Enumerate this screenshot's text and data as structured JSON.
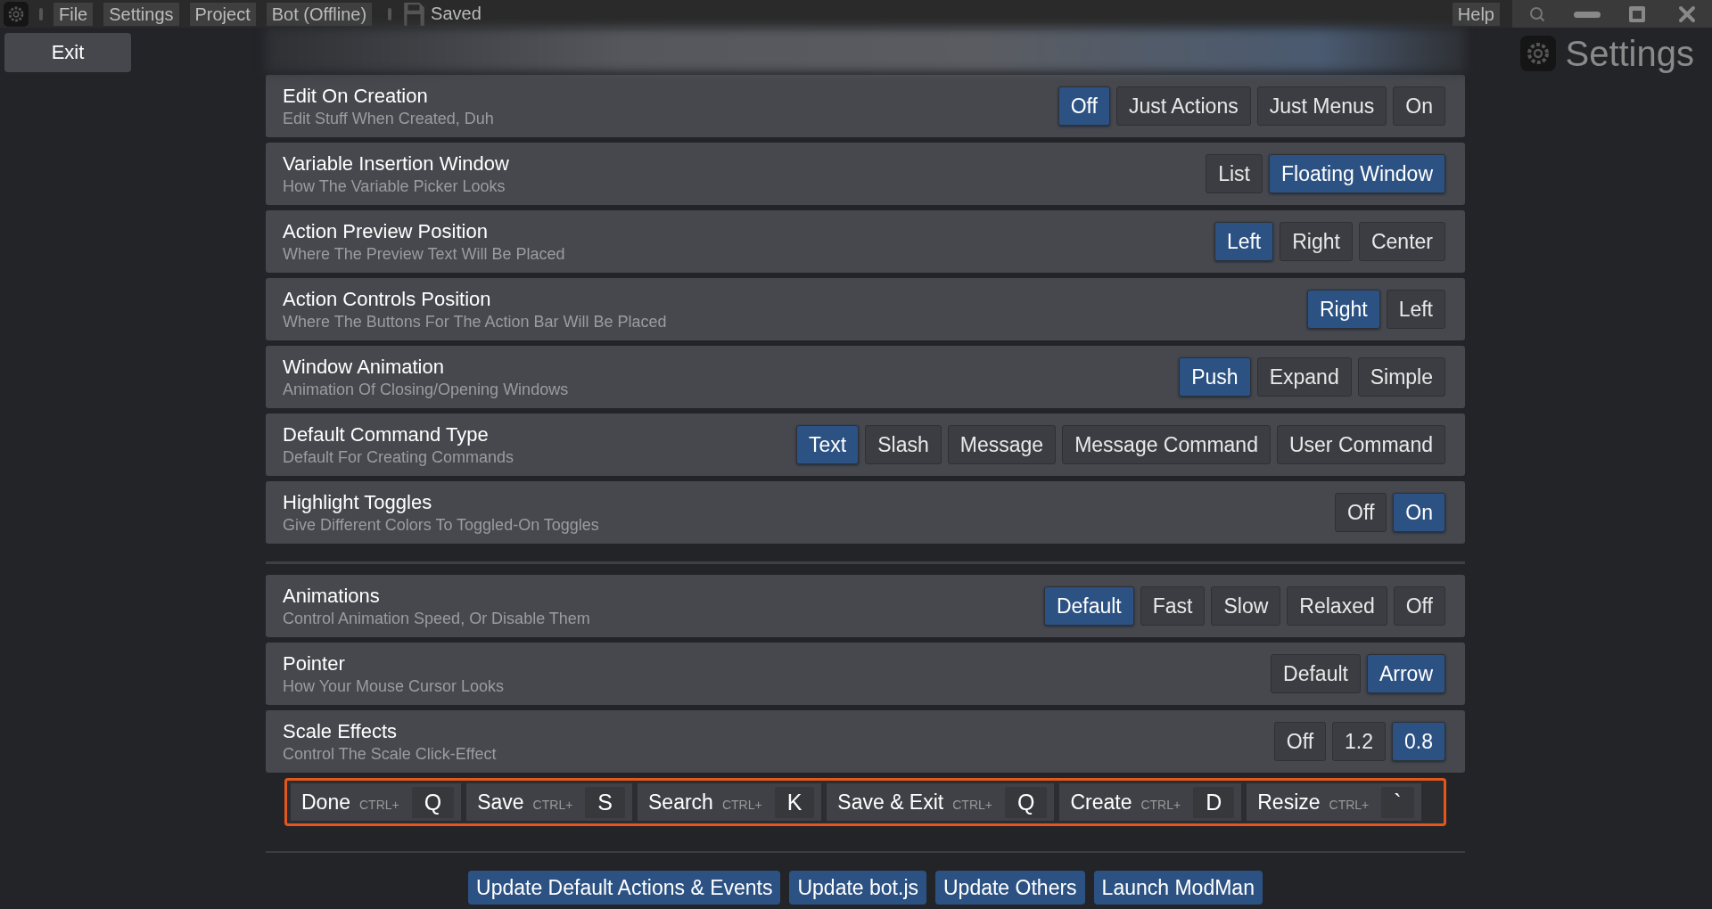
{
  "menu_bar": {
    "items": [
      "File",
      "Settings",
      "Project",
      "Bot (Offline)"
    ],
    "status": "Saved",
    "help": "Help"
  },
  "sidebar": {
    "exit_button": "Exit"
  },
  "panel_title": "Settings",
  "settings_groups": [
    {
      "settings": [
        {
          "title": "Edit On Creation",
          "description": "Edit Stuff When Created, Duh",
          "options": [
            {
              "label": "Off",
              "selected": true
            },
            {
              "label": "Just Actions",
              "selected": false
            },
            {
              "label": "Just Menus",
              "selected": false
            },
            {
              "label": "On",
              "selected": false
            }
          ]
        },
        {
          "title": "Variable Insertion Window",
          "description": "How The Variable Picker Looks",
          "options": [
            {
              "label": "List",
              "selected": false
            },
            {
              "label": "Floating Window",
              "selected": true
            }
          ]
        },
        {
          "title": "Action Preview Position",
          "description": "Where The Preview Text Will Be Placed",
          "options": [
            {
              "label": "Left",
              "selected": true
            },
            {
              "label": "Right",
              "selected": false
            },
            {
              "label": "Center",
              "selected": false
            }
          ]
        },
        {
          "title": "Action Controls Position",
          "description": "Where The Buttons For The Action Bar Will Be Placed",
          "options": [
            {
              "label": "Right",
              "selected": true
            },
            {
              "label": "Left",
              "selected": false
            }
          ]
        },
        {
          "title": "Window Animation",
          "description": "Animation Of Closing/Opening Windows",
          "options": [
            {
              "label": "Push",
              "selected": true
            },
            {
              "label": "Expand",
              "selected": false
            },
            {
              "label": "Simple",
              "selected": false
            }
          ]
        },
        {
          "title": "Default Command Type",
          "description": "Default For Creating Commands",
          "options": [
            {
              "label": "Text",
              "selected": true
            },
            {
              "label": "Slash",
              "selected": false
            },
            {
              "label": "Message",
              "selected": false
            },
            {
              "label": "Message Command",
              "selected": false
            },
            {
              "label": "User Command",
              "selected": false
            }
          ]
        },
        {
          "title": "Highlight Toggles",
          "description": "Give Different Colors To Toggled-On Toggles",
          "options": [
            {
              "label": "Off",
              "selected": false
            },
            {
              "label": "On",
              "selected": true
            }
          ]
        }
      ]
    },
    {
      "settings": [
        {
          "title": "Animations",
          "description": "Control Animation Speed, Or Disable Them",
          "options": [
            {
              "label": "Default",
              "selected": true
            },
            {
              "label": "Fast",
              "selected": false
            },
            {
              "label": "Slow",
              "selected": false
            },
            {
              "label": "Relaxed",
              "selected": false
            },
            {
              "label": "Off",
              "selected": false
            }
          ]
        },
        {
          "title": "Pointer",
          "description": "How Your Mouse Cursor Looks",
          "options": [
            {
              "label": "Default",
              "selected": false
            },
            {
              "label": "Arrow",
              "selected": true
            }
          ]
        },
        {
          "title": "Scale Effects",
          "description": "Control The Scale Click-Effect",
          "options": [
            {
              "label": "Off",
              "selected": false
            },
            {
              "label": "1.2",
              "selected": false
            },
            {
              "label": "0.8",
              "selected": true
            }
          ]
        }
      ]
    }
  ],
  "shortcuts": [
    {
      "label": "Done",
      "modifier": "CTRL+",
      "key": "Q"
    },
    {
      "label": "Save",
      "modifier": "CTRL+",
      "key": "S"
    },
    {
      "label": "Search",
      "modifier": "CTRL+",
      "key": "K"
    },
    {
      "label": "Save & Exit",
      "modifier": "CTRL+",
      "key": "Q"
    },
    {
      "label": "Create",
      "modifier": "CTRL+",
      "key": "D"
    },
    {
      "label": "Resize",
      "modifier": "CTRL+",
      "key": "`"
    }
  ],
  "footer_buttons": [
    "Update Default Actions & Events",
    "Update bot.js",
    "Update Others",
    "Launch ModMan"
  ]
}
